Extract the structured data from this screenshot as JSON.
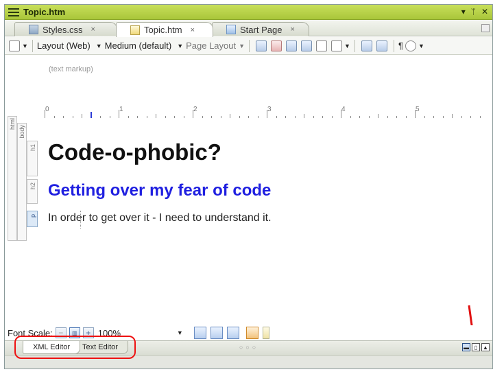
{
  "window": {
    "title": "Topic.htm"
  },
  "title_controls": {
    "dropdown": "▾",
    "pin": "ᛘ",
    "close": "✕"
  },
  "tabs": [
    {
      "label": "Styles.css",
      "close": "×"
    },
    {
      "label": "Topic.htm",
      "close": "×"
    },
    {
      "label": "Start Page",
      "close": "×"
    }
  ],
  "toolbar": {
    "layout": "Layout (Web)",
    "medium": "Medium (default)",
    "page_layout": "Page Layout",
    "pilcrow": "¶"
  },
  "editor": {
    "text_markup_label": "(text markup)",
    "ruler_numbers": [
      "0",
      "1",
      "2",
      "3",
      "4",
      "5"
    ],
    "structure": {
      "html": "html",
      "body": "body",
      "h1": "h1",
      "h2": "h2",
      "p": "p"
    },
    "heading1": "Code-o-phobic?",
    "heading2": "Getting over my fear of code",
    "paragraph": "In order to get over it - I need to understand it."
  },
  "font_scale": {
    "label": "Font Scale:",
    "minus": "−",
    "plus": "+",
    "value": "100%"
  },
  "bottom_tabs": {
    "xml": "XML Editor",
    "text": "Text Editor"
  },
  "colors": {
    "title_bar": "#b5cf48",
    "heading2": "#1f1fe0",
    "annotation": "#e11111"
  }
}
